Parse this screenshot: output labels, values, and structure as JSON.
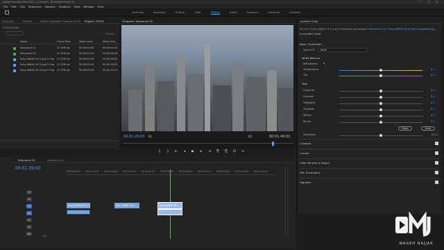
{
  "window": {
    "title": "Adobe Premiere Pro 2022 - C:\\Users\\...\\Premiere Pro\\22.0\\",
    "controls": [
      "—",
      "▢",
      "✕"
    ]
  },
  "menu": [
    "File",
    "Edit",
    "Clip",
    "Sequence",
    "Markers",
    "Graphics",
    "View",
    "Window",
    "Help"
  ],
  "workspaces": {
    "items": [
      "Learning",
      "Assembly",
      "Editing",
      "Color",
      "Effects",
      "Audio",
      "Graphics",
      "Captions",
      "Libraries"
    ],
    "active": "Effects"
  },
  "project": {
    "tabs": [
      "Libraries",
      "Effects",
      "Audio Clip Mixer: Sequence 02",
      "Project: 22324"
    ],
    "path": "22324.prproj",
    "item_count": "5 Items",
    "columns": [
      "Name",
      "Frame Rate",
      "Media Start",
      "Media End"
    ],
    "rows": [
      {
        "name": "Sequence 01",
        "fps": "23.976 fps",
        "start": "00:00:00:00",
        "end": "00:00:09:23",
        "color": "#4ea54e"
      },
      {
        "name": "Sequence 02",
        "fps": "23.976 fps",
        "start": "00:00:00:00",
        "end": "00:00:06:08",
        "color": "#4ea54e"
      },
      {
        "name": "Sony A6600 4K S-Log 3 Ung",
        "fps": "23.976 fps",
        "start": "00:00:00:00",
        "end": "00:00:16:03",
        "color": "#5aa0ff"
      },
      {
        "name": "Sony A6600 4K S-Log 3 Ung",
        "fps": "23.976 fps",
        "start": "00:00:00:00",
        "end": "00:00:18:23",
        "color": "#5aa0ff"
      },
      {
        "name": "Sony A6600 4K S-Log 3 Ung",
        "fps": "23.976 fps",
        "start": "00:00:00:00",
        "end": "00:00:12:15",
        "color": "#5aa0ff"
      }
    ]
  },
  "program": {
    "tab": "Program: Sequence 02",
    "timecode": "00:01:29:03",
    "fit": "Fit",
    "quality": "1/2",
    "duration": "00:01:40:01",
    "buttons": [
      "{",
      "}",
      "⇤",
      "◂",
      "▶",
      "▸",
      "⇥",
      "⎘",
      "⎗",
      "⊡",
      "+"
    ]
  },
  "timeline": {
    "tabs": [
      "Sequence 02",
      "Sequence 01"
    ],
    "timecode": "00:01:39:03",
    "ruler": [
      "00:01:04:22",
      "00:01:14:22",
      "00:01:24:22",
      "00:01:34:22",
      "00:01:44:22",
      "00:01:54:22",
      "00:01:04:22",
      "00:01:14:22",
      "00:01:24:22",
      "00:01:34:22",
      "00:01:44:22"
    ],
    "tracks": [
      "V3",
      "V2",
      "V1",
      "A1",
      "A2",
      "A3",
      "Mix"
    ],
    "clips": [
      {
        "name": "Sony A6600 4K S-Lo",
        "selected": false
      },
      {
        "name": "Sony A6600 4K S",
        "selected": false
      },
      {
        "name": "Sony A6600 4K",
        "selected": true
      }
    ],
    "mix_value": "0.0",
    "tools": [
      "▸",
      "⤷",
      "⇔",
      "✂",
      "⇿",
      "✎",
      "✋",
      "T"
    ]
  },
  "lumetri": {
    "title": "Lumetri Color",
    "source": "Source • Sony A6600 4K S-Log 3 Ungraded log footage f...",
    "sequence_source": "Sequence 02 • Sony A6600 4K S-Log 3 Ungraded log...",
    "effect_label": "fx  Lumetri Color",
    "basic": "Basic Correction",
    "input_lut_label": "Input LUT",
    "input_lut_value": "None",
    "white_balance": "White Balance",
    "wb_selector": "WB Selector",
    "temperature": {
      "label": "Temperature",
      "value": "0.0",
      "level": 0.5
    },
    "tint": {
      "label": "Tint",
      "value": "0.0",
      "level": 0.5
    },
    "tone": "Tone",
    "tone_rows": [
      {
        "label": "Exposure",
        "value": "0.0",
        "level": 0.5
      },
      {
        "label": "Contrast",
        "value": "0.0",
        "level": 0.5
      },
      {
        "label": "Highlights",
        "value": "0.0",
        "level": 0.5
      },
      {
        "label": "Shadows",
        "value": "0.0",
        "level": 0.5
      },
      {
        "label": "Whites",
        "value": "0.0",
        "level": 0.5
      },
      {
        "label": "Blacks",
        "value": "0.0",
        "level": 0.5
      }
    ],
    "reset": "Reset",
    "auto": "Auto",
    "saturation": {
      "label": "Saturation",
      "value": "100.0",
      "level": 0.5
    },
    "sections": [
      "Creative",
      "Curves",
      "Color Wheels & Match",
      "HSL Secondary",
      "Vignette"
    ]
  },
  "brand": {
    "text": "WAGEH NAJJAR"
  }
}
